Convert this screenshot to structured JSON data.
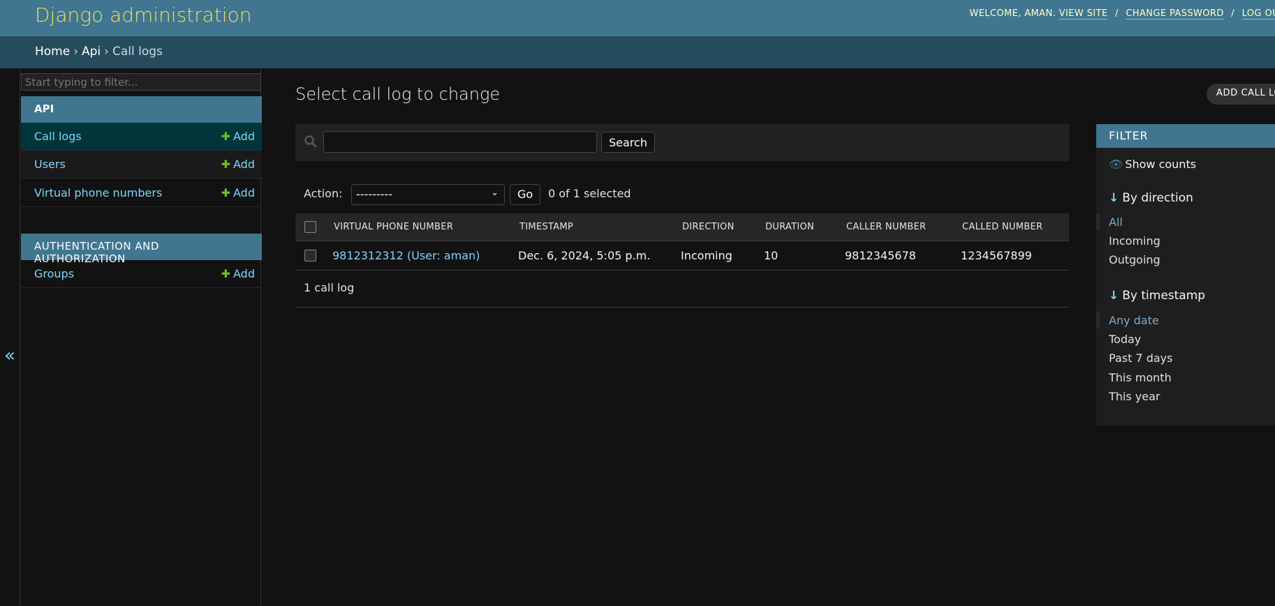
{
  "header": {
    "branding": "Django administration",
    "welcome": "WELCOME, AMAN.",
    "view_site": "VIEW SITE",
    "change_password": "CHANGE PASSWORD",
    "log_out": "LOG OU",
    "sep": "/"
  },
  "breadcrumbs": {
    "home": "Home",
    "app": "Api",
    "current": "Call logs",
    "sep": "›"
  },
  "sidebar": {
    "filter_placeholder": "Start typing to filter...",
    "api_caption": "API",
    "api_models": [
      {
        "name": "Call logs",
        "add": "Add"
      },
      {
        "name": "Users",
        "add": "Add"
      },
      {
        "name": "Virtual phone numbers",
        "add": "Add"
      }
    ],
    "auth_caption": "AUTHENTICATION AND AUTHORIZATION",
    "auth_models": [
      {
        "name": "Groups",
        "add": "Add"
      }
    ],
    "collapse": "«"
  },
  "main": {
    "title": "Select call log to change",
    "add_button": "ADD CALL LO",
    "search_button": "Search",
    "action_label": "Action:",
    "action_value": "---------",
    "go_button": "Go",
    "selected": "0 of 1 selected",
    "columns": [
      "VIRTUAL PHONE NUMBER",
      "TIMESTAMP",
      "DIRECTION",
      "DURATION",
      "CALLER NUMBER",
      "CALLED NUMBER"
    ],
    "rows": [
      [
        "9812312312 (User: aman)",
        "Dec. 6, 2024, 5:05 p.m.",
        "Incoming",
        "10",
        "9812345678",
        "1234567899"
      ]
    ],
    "paginator": "1 call log"
  },
  "filter": {
    "title": "FILTER",
    "show_counts": "Show counts",
    "direction_title": "By direction",
    "direction_items": [
      "All",
      "Incoming",
      "Outgoing"
    ],
    "timestamp_title": "By timestamp",
    "timestamp_items": [
      "Any date",
      "Today",
      "Past 7 days",
      "This month",
      "This year"
    ]
  },
  "colors": {
    "header_bg": "#417690",
    "breadcrumb_bg": "#264b5d",
    "branding": "#f5dd5d",
    "link": "#81d4fa",
    "add_plus": "#70bf2b",
    "page_bg": "#121212"
  }
}
